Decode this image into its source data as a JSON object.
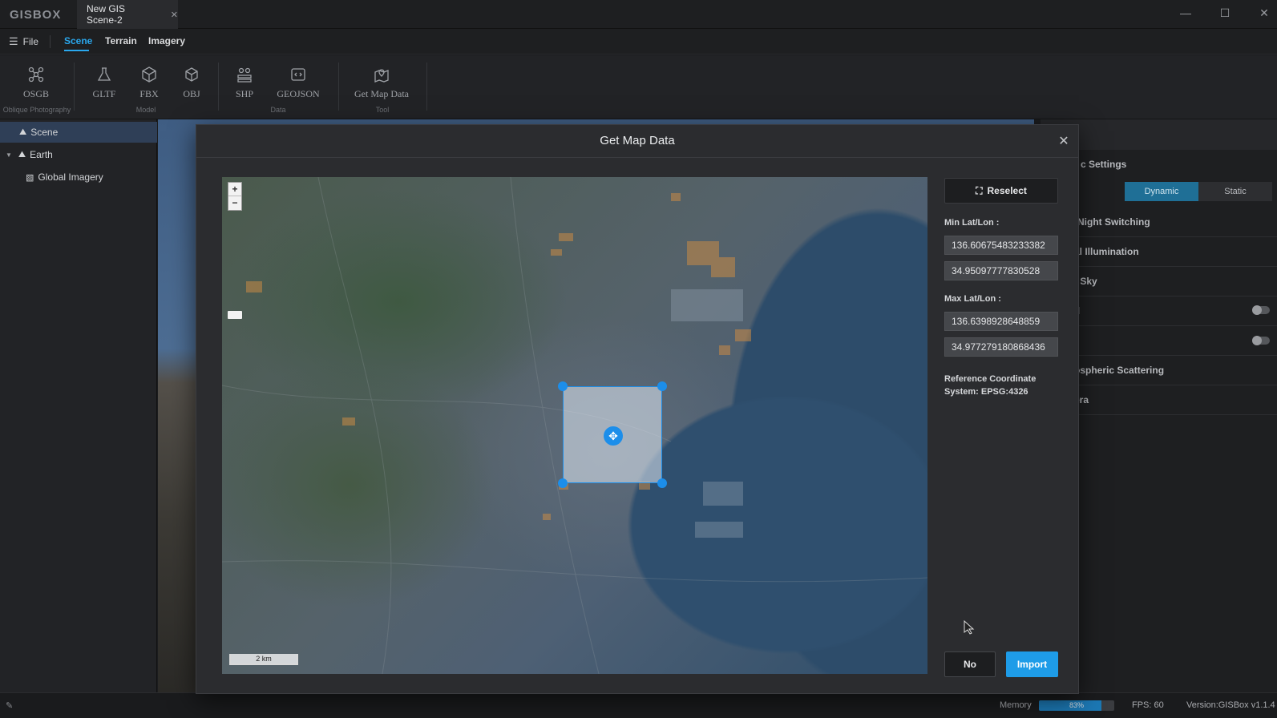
{
  "app": {
    "logo": "GISBOX",
    "tab_title": "New GIS Scene-2",
    "tab_close": "✕"
  },
  "window_controls": {
    "minimize": "—",
    "maximize": "☐",
    "close": "✕"
  },
  "menu": {
    "file": "File",
    "tabs": [
      "Scene",
      "Terrain",
      "Imagery"
    ],
    "active_tab": "Scene"
  },
  "ribbon": {
    "buttons": [
      {
        "label": "OSGB",
        "icon": "network-icon"
      },
      {
        "label": "GLTF",
        "icon": "flask-icon"
      },
      {
        "label": "FBX",
        "icon": "cube-icon"
      },
      {
        "label": "OBJ",
        "icon": "box-icon"
      },
      {
        "label": "SHP",
        "icon": "layers-icon"
      },
      {
        "label": "GEOJSON",
        "icon": "code-icon"
      },
      {
        "label": "Get Map Data",
        "icon": "map-pin-icon"
      }
    ],
    "groups": [
      "Oblique Photography",
      "Model",
      "Data",
      "Tool"
    ]
  },
  "tree": {
    "items": [
      "Scene",
      "Earth",
      "Global Imagery"
    ]
  },
  "right_panel": {
    "header": "c Settings",
    "seg_options": [
      "Dynamic",
      "Static"
    ],
    "rows": [
      "-Night Switching",
      "al Illumination",
      "t Sky",
      "d",
      "",
      "ospheric Scattering",
      "era"
    ]
  },
  "status": {
    "memory_label": "Memory",
    "memory_value": "83%",
    "memory_fraction": 0.83,
    "fps": "FPS: 60",
    "version": "Version:GISBox v1.1.4"
  },
  "dialog": {
    "title": "Get Map Data",
    "reselect_label": "Reselect",
    "min_label": "Min Lat/Lon :",
    "min_lon": "136.60675483233382",
    "min_lat": "34.95097777830528",
    "max_label": "Max Lat/Lon :",
    "max_lon": "136.6398928648859",
    "max_lat": "34.977279180868436",
    "ref_note": "Reference Coordinate System: EPSG:4326",
    "no_label": "No",
    "import_label": "Import",
    "map_scale": "2 km",
    "zoom_in": "+",
    "zoom_out": "−"
  }
}
